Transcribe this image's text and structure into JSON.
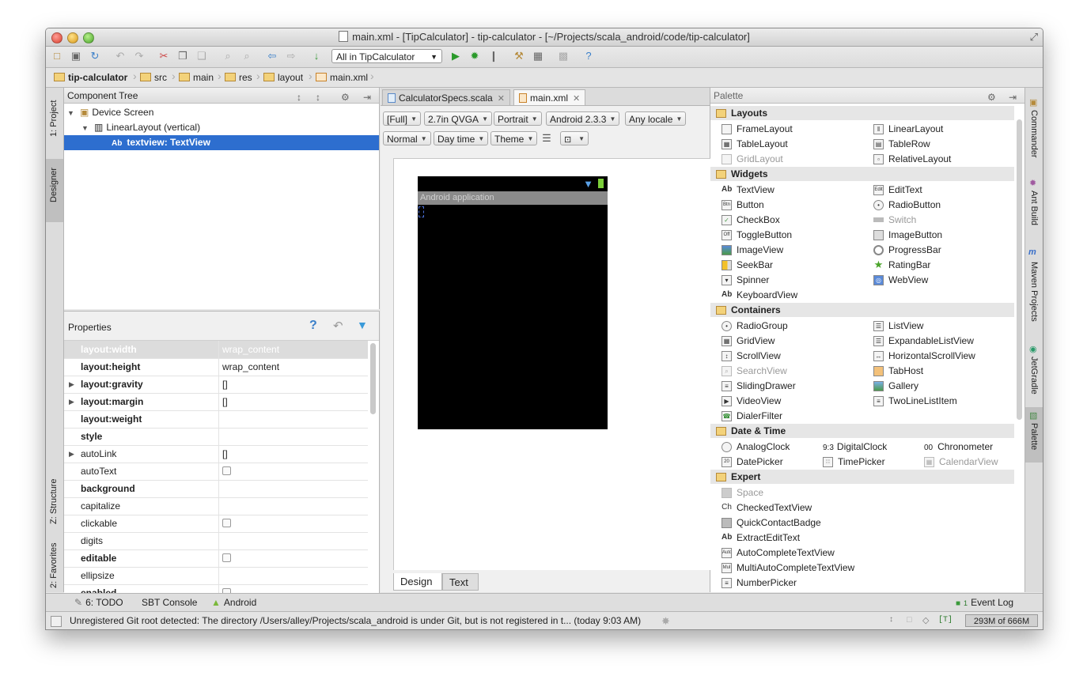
{
  "window": {
    "title": "main.xml - [TipCalculator] - tip-calculator - [~/Projects/scala_android/code/tip-calculator]"
  },
  "toolbar": {
    "run_config": "All in TipCalculator"
  },
  "breadcrumbs": [
    "tip-calculator",
    "src",
    "main",
    "res",
    "layout",
    "main.xml"
  ],
  "left_tabs": {
    "project": "1: Project",
    "designer": "Designer",
    "structure": "Z: Structure",
    "favorites": "2: Favorites"
  },
  "right_tabs": {
    "commander": "Commander",
    "ant_build": "Ant Build",
    "maven": "Maven Projects",
    "jetgradle": "JetGradle",
    "palette": "Palette"
  },
  "component_tree": {
    "title": "Component Tree",
    "nodes": [
      "Device Screen",
      "LinearLayout (vertical)",
      "textview: TextView"
    ]
  },
  "properties": {
    "title": "Properties",
    "rows": [
      {
        "name": "layout:width",
        "value": "wrap_content"
      },
      {
        "name": "layout:height",
        "value": "wrap_content"
      },
      {
        "name": "layout:gravity",
        "value": "[]"
      },
      {
        "name": "layout:margin",
        "value": "[]"
      },
      {
        "name": "layout:weight",
        "value": ""
      },
      {
        "name": "style",
        "value": ""
      },
      {
        "name": "autoLink",
        "value": "[]"
      },
      {
        "name": "autoText",
        "value": ""
      },
      {
        "name": "background",
        "value": ""
      },
      {
        "name": "capitalize",
        "value": ""
      },
      {
        "name": "clickable",
        "value": ""
      },
      {
        "name": "digits",
        "value": ""
      },
      {
        "name": "editable",
        "value": ""
      },
      {
        "name": "ellipsize",
        "value": ""
      },
      {
        "name": "enabled",
        "value": ""
      }
    ]
  },
  "editor": {
    "tabs": [
      "CalculatorSpecs.scala",
      "main.xml"
    ],
    "config": [
      "[Full]",
      "2.7in QVGA",
      "Portrait",
      "Android 2.3.3",
      "Any locale",
      "Normal",
      "Day time",
      "Theme"
    ],
    "app_title": "Android application",
    "bottom_tabs": [
      "Design",
      "Text"
    ]
  },
  "palette": {
    "title": "Palette",
    "categories": [
      {
        "name": "Layouts",
        "items": [
          "FrameLayout",
          "LinearLayout",
          "TableLayout",
          "TableRow",
          "GridLayout",
          "RelativeLayout"
        ]
      },
      {
        "name": "Widgets",
        "items": [
          "TextView",
          "EditText",
          "Button",
          "RadioButton",
          "CheckBox",
          "Switch",
          "ToggleButton",
          "ImageButton",
          "ImageView",
          "ProgressBar",
          "SeekBar",
          "RatingBar",
          "Spinner",
          "WebView",
          "KeyboardView"
        ]
      },
      {
        "name": "Containers",
        "items": [
          "RadioGroup",
          "ListView",
          "GridView",
          "ExpandableListView",
          "ScrollView",
          "HorizontalScrollView",
          "SearchView",
          "TabHost",
          "SlidingDrawer",
          "Gallery",
          "VideoView",
          "TwoLineListItem",
          "DialerFilter"
        ]
      },
      {
        "name": "Date & Time",
        "items": [
          "AnalogClock",
          "DigitalClock",
          "Chronometer",
          "DatePicker",
          "TimePicker",
          "CalendarView"
        ]
      },
      {
        "name": "Expert",
        "items": [
          "Space",
          "CheckedTextView",
          "QuickContactBadge",
          "ExtractEditText",
          "AutoCompleteTextView",
          "MultiAutoCompleteTextView",
          "NumberPicker"
        ]
      }
    ]
  },
  "bottom_bar": {
    "todo": "6: TODO",
    "sbt": "SBT Console",
    "android": "Android",
    "event_log": "Event Log",
    "event_count": "1"
  },
  "status_bar": {
    "message": "Unregistered Git root detected: The directory /Users/alley/Projects/scala_android is under Git, but is not registered in t... (today 9:03 AM)",
    "memory": "293M of 666M",
    "insert_mode": "[T]"
  }
}
